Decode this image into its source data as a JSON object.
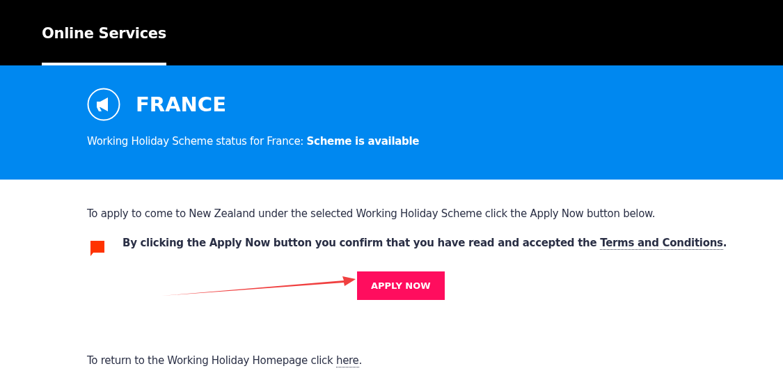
{
  "header": {
    "tabs": [
      {
        "label": "Online Services",
        "selected": true
      }
    ]
  },
  "banner": {
    "title": "FRANCE",
    "status": "Working Holiday Scheme status for France: **Scheme is available**"
  },
  "intro": "To apply to come to New Zealand under the selected Working Holiday Scheme click the Apply Now button below.",
  "notice": {
    "text": "By clicking the Apply Now button you confirm that you have read and accepted the ",
    "link": "Terms and Conditions",
    "end": "."
  },
  "apply_button": "APPLY NOW",
  "return": {
    "text": "To return to the Working Holiday Homepage click ",
    "link": "here",
    "end": "."
  }
}
